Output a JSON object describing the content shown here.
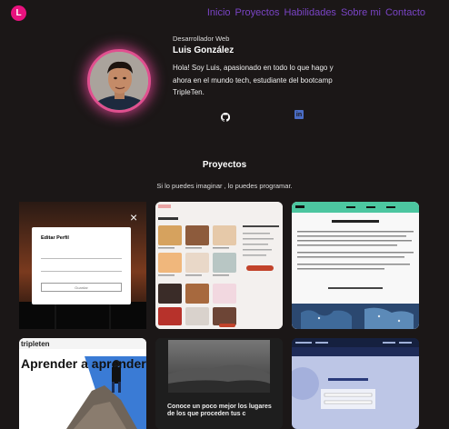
{
  "logo": {
    "letter": "L"
  },
  "nav": [
    "Inicio",
    "Proyectos",
    "Habilidades",
    "Sobre mi",
    "Contacto"
  ],
  "profile": {
    "role": "Desarrollador Web",
    "name": "Luis González",
    "bio": "Hola! Soy Luis, apasionado en todo lo que hago y ahora en el mundo tech, estudiante del bootcamp TripleTen."
  },
  "social": {
    "github_icon": "github-icon",
    "linkedin_icon": "linkedin-icon",
    "linkedin_text": "in"
  },
  "projects": {
    "title": "Proyectos",
    "subtitle": "Si lo puedes imaginar , lo puedes programar.",
    "card1": {
      "modal_title": "Editar Perfil",
      "button_label": "Guardar"
    },
    "card4": {
      "brand": "tripleten",
      "headline": "Aprender a aprender"
    },
    "card5": {
      "text": "Conoce un poco mejor los lugares de los que proceden tus c"
    }
  },
  "colors": {
    "accent": "#e8127e",
    "nav": "#7a44c5",
    "background": "#1b1717"
  }
}
